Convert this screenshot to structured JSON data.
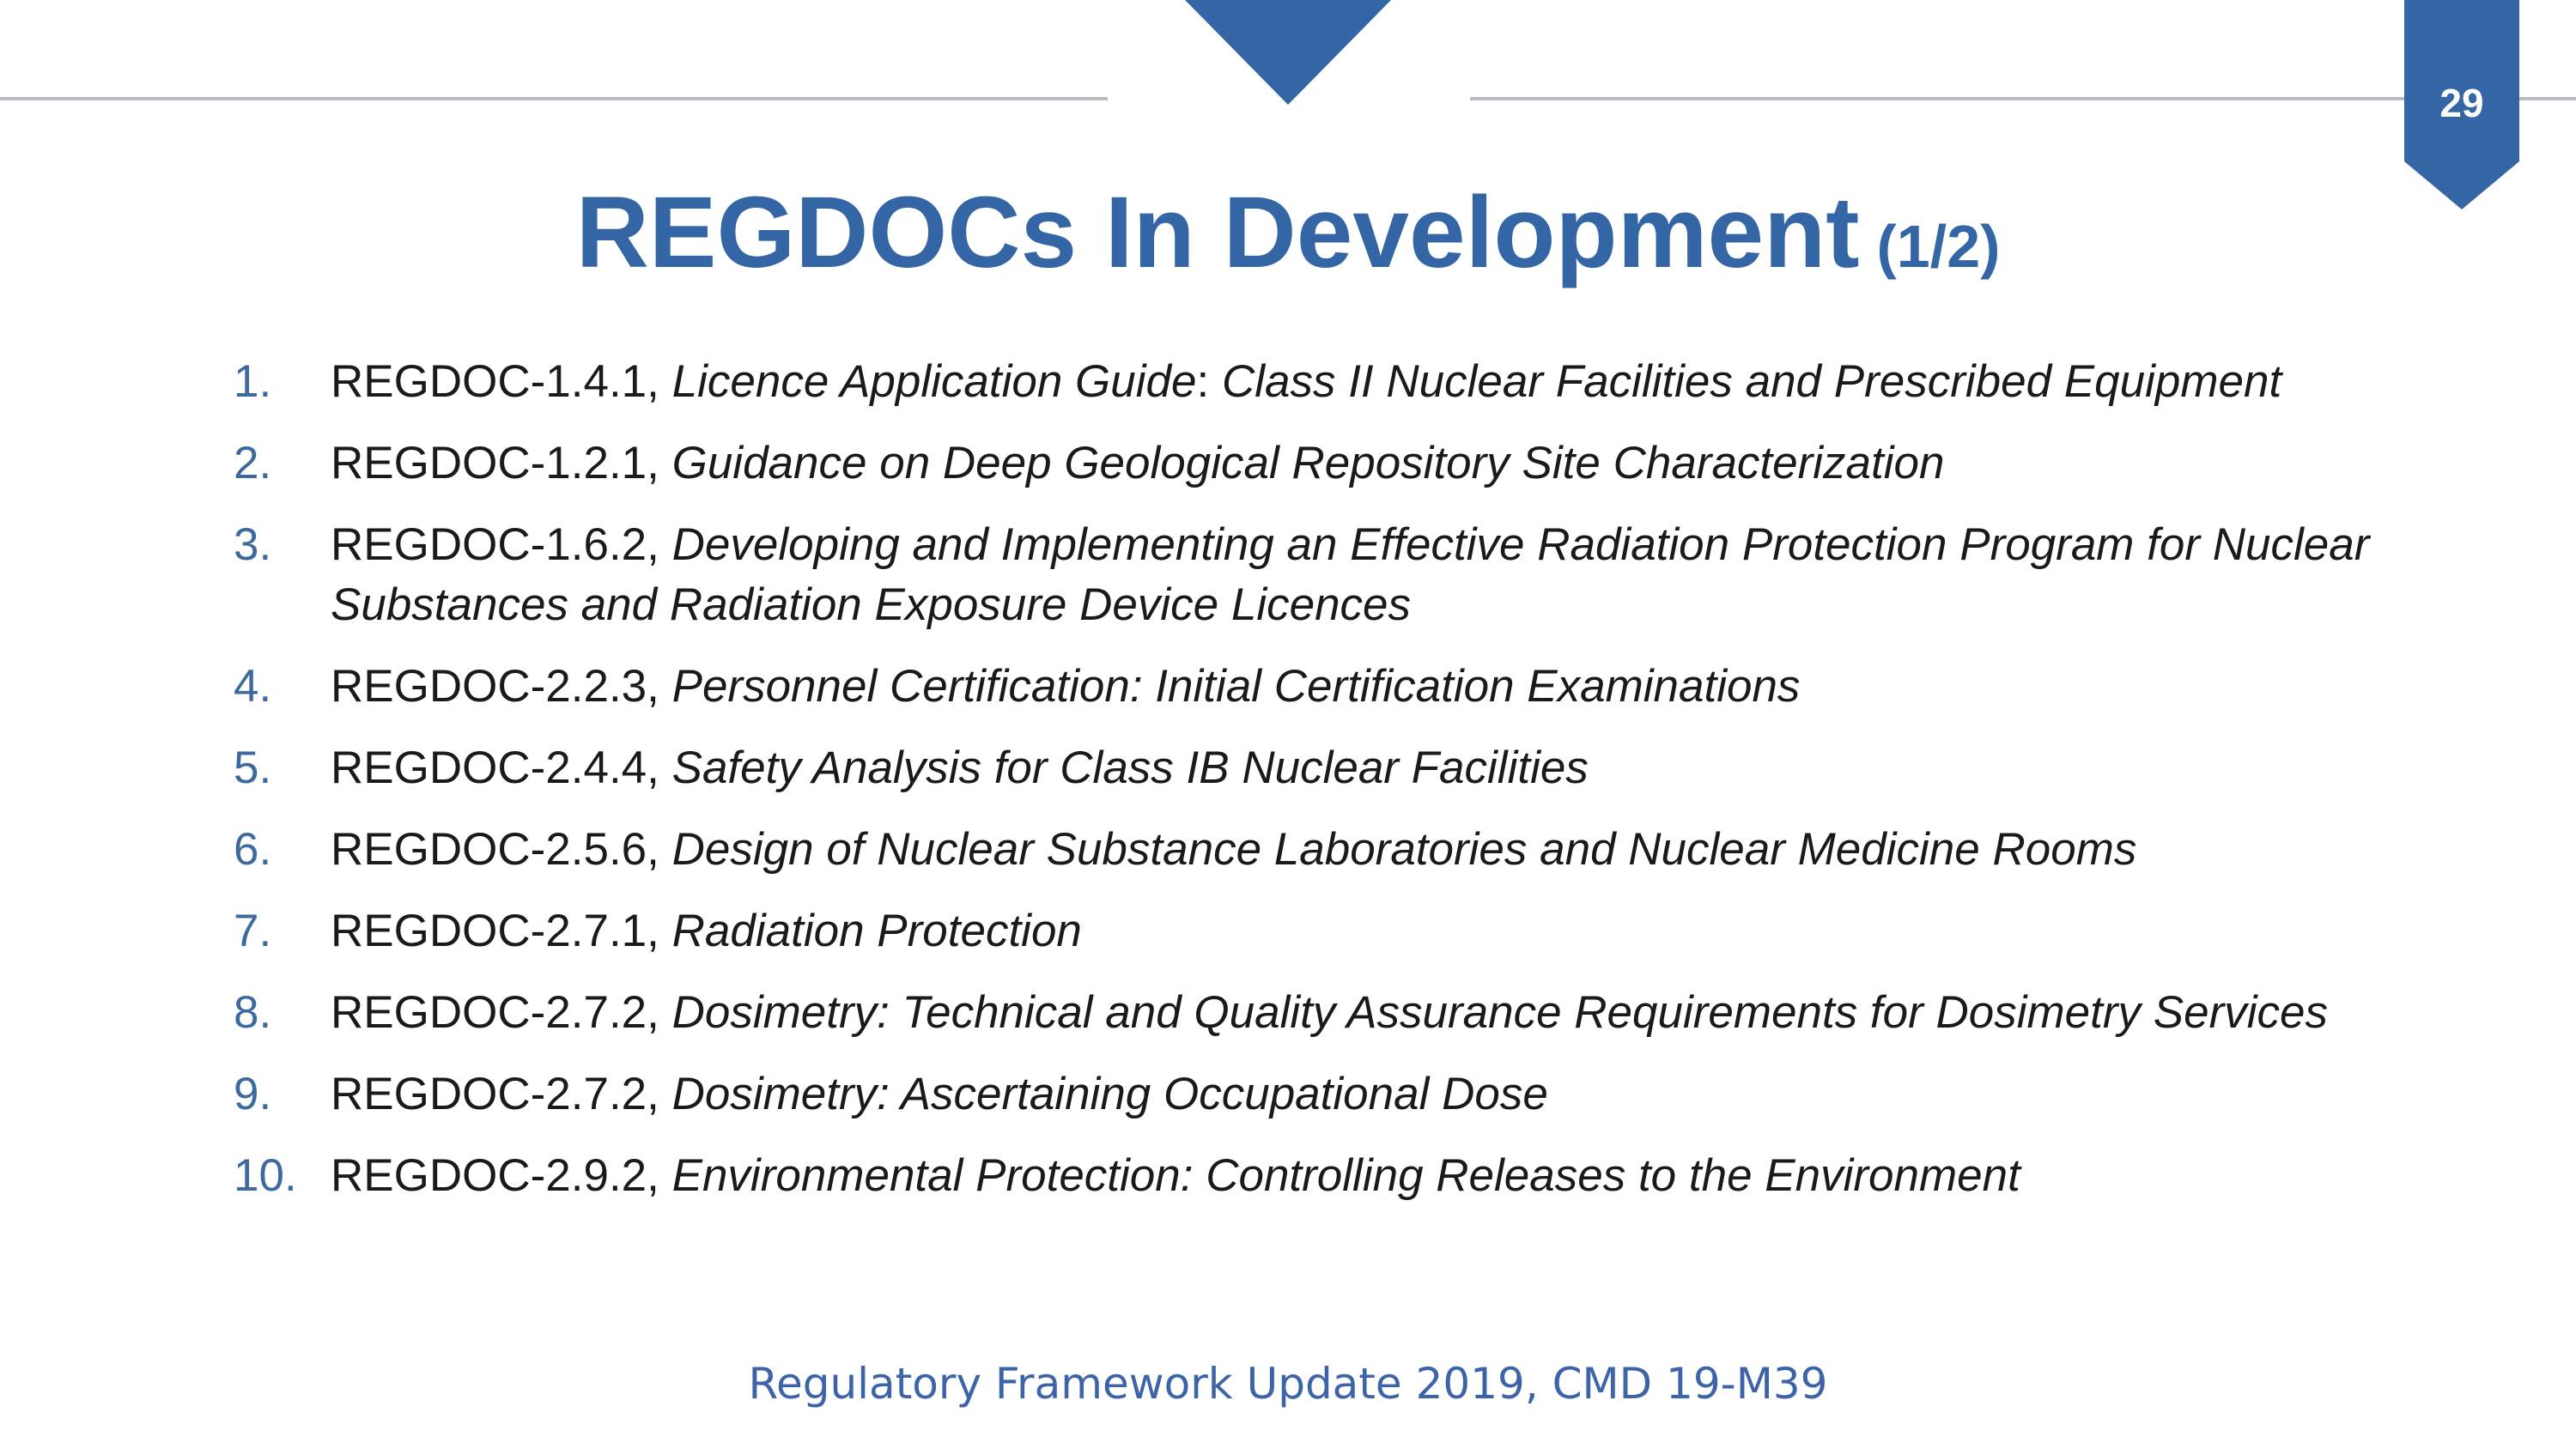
{
  "slide": {
    "page_number": "29",
    "title": "REGDOCs In Development",
    "title_part": "(1/2)",
    "footer": "Regulatory Framework Update 2019, CMD 19-M39",
    "accent_color": "#3465a4",
    "rule_color": "#b8bcc2"
  },
  "items": [
    {
      "num": "1.",
      "code": "REGDOC-1.4.1, ",
      "title": "Licence Application Guide",
      "sep": ": ",
      "subtitle": "Class II Nuclear Facilities and Prescribed Equipment"
    },
    {
      "num": "2.",
      "code": "REGDOC-1.2.1, ",
      "title": "Guidance on Deep Geological Repository Site Characterization"
    },
    {
      "num": "3.",
      "code": "REGDOC-1.6.2, ",
      "title": "Developing and Implementing an Effective Radiation Protection Program for Nuclear Substances and Radiation Exposure Device Licences"
    },
    {
      "num": "4.",
      "code": "REGDOC-2.2.3, ",
      "title": "Personnel Certification: Initial Certification Examinations"
    },
    {
      "num": "5.",
      "code": "REGDOC-2.4.4, ",
      "title": "Safety Analysis for Class IB Nuclear Facilities"
    },
    {
      "num": "6.",
      "code": "REGDOC-2.5.6, ",
      "title": "Design of Nuclear Substance Laboratories and Nuclear Medicine Rooms"
    },
    {
      "num": "7.",
      "code": "REGDOC-2.7.1, ",
      "title": "Radiation Protection"
    },
    {
      "num": "8.",
      "code": "REGDOC-2.7.2, ",
      "title": "Dosimetry: Technical and Quality Assurance Requirements for Dosimetry Services"
    },
    {
      "num": "9.",
      "code": "REGDOC-2.7.2, ",
      "title": "Dosimetry: Ascertaining Occupational Dose"
    },
    {
      "num": "10.",
      "code": "REGDOC-2.9.2, ",
      "title": "Environmental Protection: Controlling Releases to the Environment"
    }
  ]
}
